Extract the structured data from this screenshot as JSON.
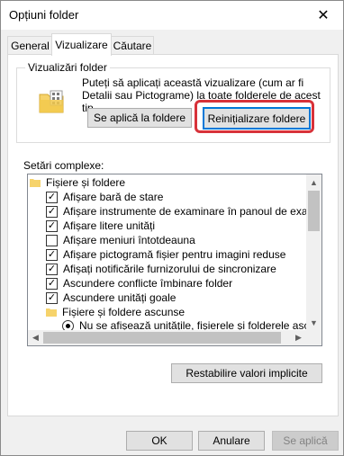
{
  "window": {
    "title": "Opțiuni folder",
    "close_glyph": "✕"
  },
  "tabs": [
    {
      "label": "General"
    },
    {
      "label": "Vizualizare"
    },
    {
      "label": "Căutare"
    }
  ],
  "folder_views": {
    "group_title": "Vizualizări folder",
    "description": "Puteți să aplicați această vizualizare (cum ar fi Detalii sau Pictograme) la toate folderele de acest tip.",
    "apply_button": "Se aplică la foldere",
    "reset_button": "Reinițializare foldere"
  },
  "advanced": {
    "label": "Setări complexe:",
    "items": [
      {
        "kind": "folder",
        "label": "Fișiere și foldere"
      },
      {
        "kind": "checkbox",
        "checked": true,
        "label": "Afișare bară de stare"
      },
      {
        "kind": "checkbox",
        "checked": true,
        "label": "Afișare instrumente de examinare în panoul de examinare"
      },
      {
        "kind": "checkbox",
        "checked": true,
        "label": "Afișare litere unități"
      },
      {
        "kind": "checkbox",
        "checked": false,
        "label": "Afișare meniuri întotdeauna"
      },
      {
        "kind": "checkbox",
        "checked": true,
        "label": "Afișare pictogramă fișier pentru imagini reduse"
      },
      {
        "kind": "checkbox",
        "checked": true,
        "label": "Afișați notificările furnizorului de sincronizare"
      },
      {
        "kind": "checkbox",
        "checked": true,
        "label": "Ascundere conflicte îmbinare folder"
      },
      {
        "kind": "checkbox",
        "checked": true,
        "label": "Ascundere unități goale"
      },
      {
        "kind": "folder",
        "label": "Fișiere și foldere ascunse"
      },
      {
        "kind": "radio",
        "checked": true,
        "label": "Nu se afișează unitățile, fișierele și folderele ascunse"
      }
    ]
  },
  "restore_button": "Restabilire valori implicite",
  "footer": {
    "ok": "OK",
    "cancel": "Anulare",
    "apply": "Se aplică"
  },
  "colors": {
    "highlight": "#d7323a",
    "focus": "#0078d7",
    "folder": "#f6d36b"
  }
}
